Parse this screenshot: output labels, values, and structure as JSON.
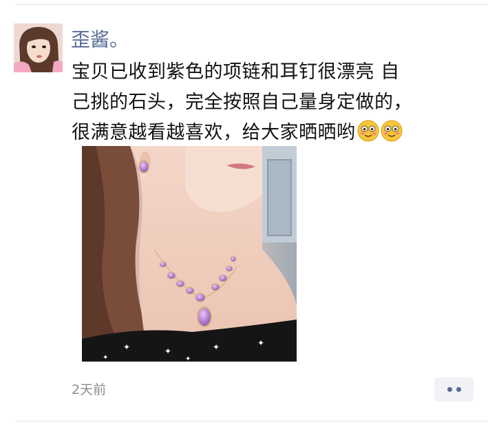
{
  "post": {
    "author": "歪酱。",
    "text_lines": [
      "宝贝已收到紫色的项链和耳钉很漂亮 自",
      "己挑的石头，完全按照自己量身定做的，",
      "很满意越看越喜欢，给大家晒晒哟"
    ],
    "emojis": [
      "blush-emoji",
      "blush-emoji"
    ],
    "timestamp": "2天前",
    "photo": "woman-wearing-purple-jade-necklace-and-earring"
  },
  "actions": {
    "more_icon": "more-dots-icon"
  },
  "colors": {
    "author_name": "#576b95",
    "text": "#111111",
    "timestamp": "#8c8c8c",
    "more_button_bg": "#f1f2f5",
    "divider": "#e6e6e6"
  }
}
